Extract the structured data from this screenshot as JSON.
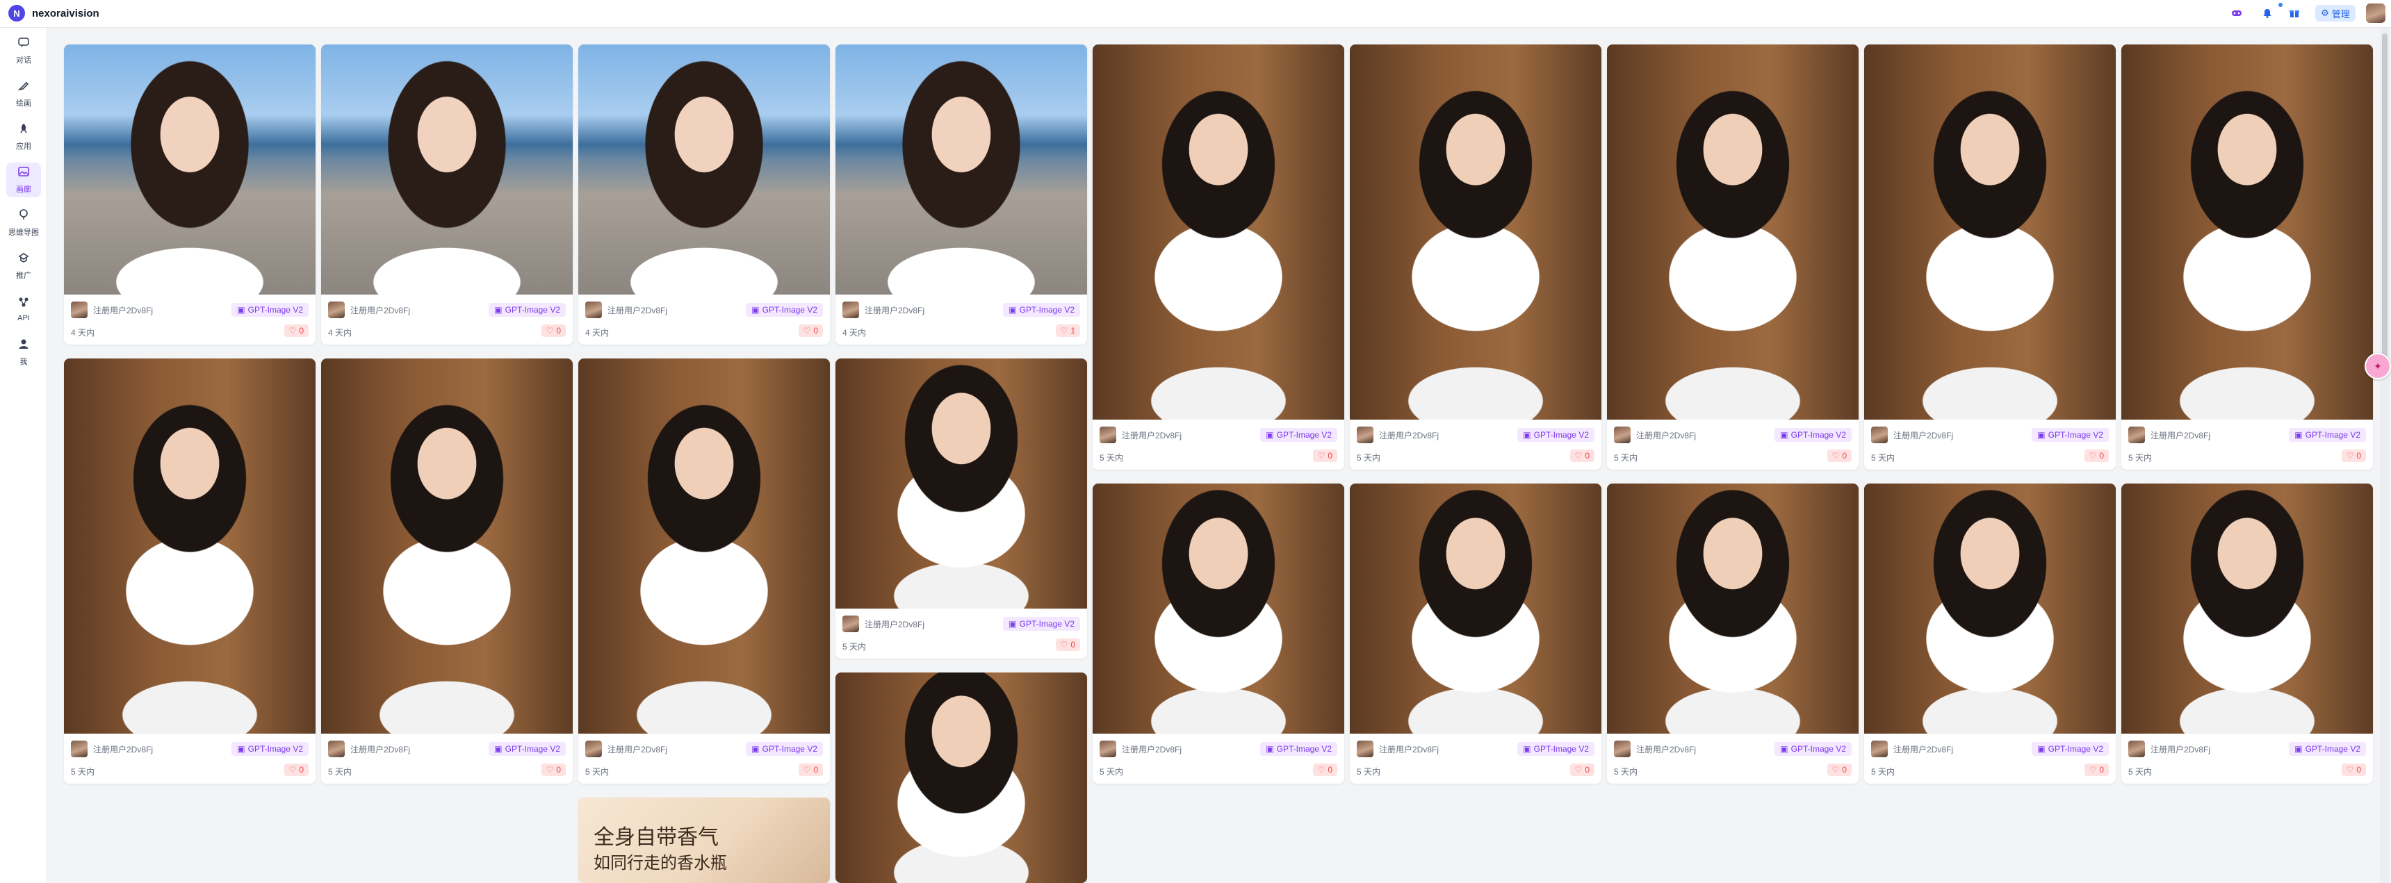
{
  "app": {
    "brand": "nexoraivision",
    "logo_char": "N"
  },
  "topbar": {
    "icons": [
      "gamepad-icon",
      "bell-icon",
      "gift-icon"
    ],
    "admin_label": "管理"
  },
  "sidebar": {
    "items": [
      {
        "label": "对话",
        "icon": "chat-icon"
      },
      {
        "label": "绘画",
        "icon": "brush-icon"
      },
      {
        "label": "应用",
        "icon": "rocket-icon"
      },
      {
        "label": "画廊",
        "icon": "gallery-icon",
        "active": true
      },
      {
        "label": "思维导图",
        "icon": "mindmap-icon"
      },
      {
        "label": "推广",
        "icon": "promo-icon"
      },
      {
        "label": "API",
        "icon": "api-icon"
      },
      {
        "label": "我",
        "icon": "user-icon"
      }
    ]
  },
  "gallery": {
    "cards": [
      {
        "author": "注册用户2Dv8Fj",
        "model": "GPT-Image V2",
        "time": "4 天内",
        "likes": "0",
        "theme": "beach"
      },
      {
        "author": "注册用户2Dv8Fj",
        "model": "GPT-Image V2",
        "time": "4 天内",
        "likes": "0",
        "theme": "beach"
      },
      {
        "author": "注册用户2Dv8Fj",
        "model": "GPT-Image V2",
        "time": "4 天内",
        "likes": "0",
        "theme": "beach"
      },
      {
        "author": "注册用户2Dv8Fj",
        "model": "GPT-Image V2",
        "time": "4 天内",
        "likes": "1",
        "theme": "beach"
      },
      {
        "author": "注册用户2Dv8Fj",
        "model": "GPT-Image V2",
        "time": "5 天内",
        "likes": "0",
        "theme": "room"
      },
      {
        "author": "注册用户2Dv8Fj",
        "model": "GPT-Image V2",
        "time": "5 天内",
        "likes": "0",
        "theme": "room"
      },
      {
        "author": "注册用户2Dv8Fj",
        "model": "GPT-Image V2",
        "time": "5 天内",
        "likes": "0",
        "theme": "room"
      },
      {
        "author": "注册用户2Dv8Fj",
        "model": "GPT-Image V2",
        "time": "5 天内",
        "likes": "0",
        "theme": "room"
      },
      {
        "author": "注册用户2Dv8Fj",
        "model": "GPT-Image V2",
        "time": "5 天内",
        "likes": "0",
        "theme": "room"
      },
      {
        "author": "注册用户2Dv8Fj",
        "model": "GPT-Image V2",
        "time": "5 天内",
        "likes": "0",
        "theme": "room"
      },
      {
        "author": "注册用户2Dv8Fj",
        "model": "GPT-Image V2",
        "time": "5 天内",
        "likes": "0",
        "theme": "room"
      },
      {
        "author": "注册用户2Dv8Fj",
        "model": "GPT-Image V2",
        "time": "5 天内",
        "likes": "0",
        "theme": "room"
      },
      {
        "author": "注册用户2Dv8Fj",
        "model": "GPT-Image V2",
        "time": "5 天内",
        "likes": "0",
        "theme": "room"
      },
      {
        "author": "注册用户2Dv8Fj",
        "model": "GPT-Image V2",
        "time": "5 天内",
        "likes": "0",
        "theme": "room"
      },
      {
        "author": "注册用户2Dv8Fj",
        "model": "GPT-Image V2",
        "time": "5 天内",
        "likes": "0",
        "theme": "room"
      },
      {
        "author": "注册用户2Dv8Fj",
        "model": "GPT-Image V2",
        "time": "5 天内",
        "likes": "0",
        "theme": "room"
      },
      {
        "author": "注册用户2Dv8Fj",
        "model": "GPT-Image V2",
        "time": "5 天内",
        "likes": "0",
        "theme": "room"
      },
      {
        "author": "注册用户2Dv8Fj",
        "model": "GPT-Image V2",
        "time": "5 天内",
        "likes": "0",
        "theme": "room"
      }
    ],
    "partial_images": [
      {
        "theme": "room"
      },
      {
        "theme": "ad",
        "lines": [
          "全身自带香气",
          "如同行走的香水瓶"
        ]
      }
    ]
  },
  "colors": {
    "accent": "#7c3aed",
    "like": "#ef4444",
    "admin": "#2563eb"
  }
}
